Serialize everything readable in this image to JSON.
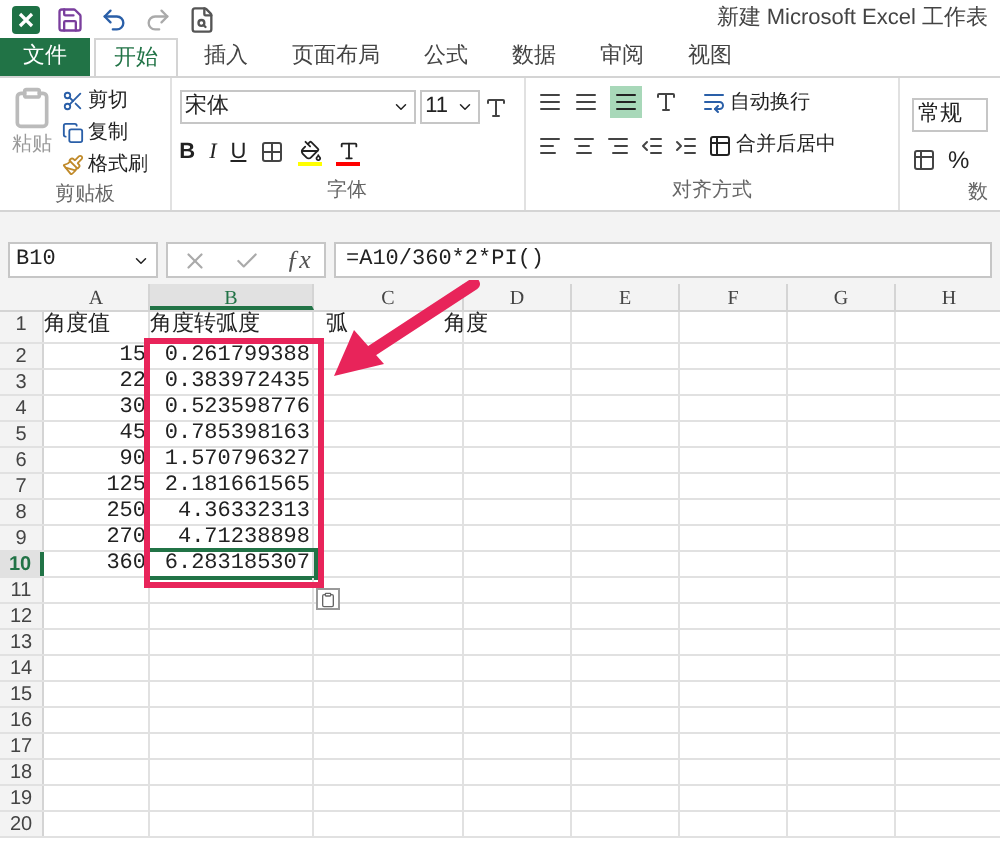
{
  "title_bar": {
    "title": "新建 Microsoft Excel 工作表"
  },
  "ribbon_tabs": [
    {
      "label": "文件",
      "kind": "file",
      "selected": false
    },
    {
      "label": "开始",
      "kind": "tab",
      "selected": true
    },
    {
      "label": "插入",
      "kind": "tab",
      "selected": false
    },
    {
      "label": "页面布局",
      "kind": "tab",
      "selected": false
    },
    {
      "label": "公式",
      "kind": "tab",
      "selected": false
    },
    {
      "label": "数据",
      "kind": "tab",
      "selected": false
    },
    {
      "label": "审阅",
      "kind": "tab",
      "selected": false
    },
    {
      "label": "视图",
      "kind": "tab",
      "selected": false
    }
  ],
  "clipboard": {
    "paste": "粘贴",
    "cut": "剪切",
    "copy": "复制",
    "format_painter": "格式刷",
    "group_label": "剪贴板"
  },
  "font": {
    "font_name": "宋体",
    "font_size": "11",
    "bold": "B",
    "italic": "I",
    "underline": "U",
    "group_label": "字体"
  },
  "alignment": {
    "wrap_text": "自动换行",
    "merge_center": "合并后居中",
    "group_label": "对齐方式"
  },
  "number": {
    "format": "常规",
    "percent": "%",
    "group_label": "数"
  },
  "formula_bar": {
    "name_box": "B10",
    "function_label": "ƒx",
    "formula": "=A10/360*2*PI()"
  },
  "sheet": {
    "columns": [
      {
        "label": "A",
        "selected": false
      },
      {
        "label": "B",
        "selected": true
      },
      {
        "label": "C",
        "selected": false
      },
      {
        "label": "D",
        "selected": false
      },
      {
        "label": "E",
        "selected": false
      },
      {
        "label": "F",
        "selected": false
      },
      {
        "label": "G",
        "selected": false
      },
      {
        "label": "H",
        "selected": false
      }
    ],
    "rows": [
      {
        "number": "1",
        "selected": false,
        "cells": [
          "角度值",
          "角度转弧度"
        ],
        "c_fragments": [
          "弧",
          "角度"
        ]
      },
      {
        "number": "2",
        "selected": false,
        "cells": [
          "15",
          "0.261799388"
        ]
      },
      {
        "number": "3",
        "selected": false,
        "cells": [
          "22",
          "0.383972435"
        ]
      },
      {
        "number": "4",
        "selected": false,
        "cells": [
          "30",
          "0.523598776"
        ]
      },
      {
        "number": "5",
        "selected": false,
        "cells": [
          "45",
          "0.785398163"
        ]
      },
      {
        "number": "6",
        "selected": false,
        "cells": [
          "90",
          "1.570796327"
        ]
      },
      {
        "number": "7",
        "selected": false,
        "cells": [
          "125",
          "2.181661565"
        ]
      },
      {
        "number": "8",
        "selected": false,
        "cells": [
          "250",
          "4.36332313"
        ]
      },
      {
        "number": "9",
        "selected": false,
        "cells": [
          "270",
          "4.71238898"
        ]
      },
      {
        "number": "10",
        "selected": true,
        "cells": [
          "360",
          "6.283185307"
        ]
      },
      {
        "number": "11",
        "selected": false,
        "cells": []
      },
      {
        "number": "12",
        "selected": false,
        "cells": []
      },
      {
        "number": "13",
        "selected": false,
        "cells": []
      },
      {
        "number": "14",
        "selected": false,
        "cells": []
      },
      {
        "number": "15",
        "selected": false,
        "cells": []
      },
      {
        "number": "16",
        "selected": false,
        "cells": []
      },
      {
        "number": "17",
        "selected": false,
        "cells": []
      },
      {
        "number": "18",
        "selected": false,
        "cells": []
      },
      {
        "number": "19",
        "selected": false,
        "cells": []
      },
      {
        "number": "20",
        "selected": false,
        "cells": []
      }
    ]
  }
}
